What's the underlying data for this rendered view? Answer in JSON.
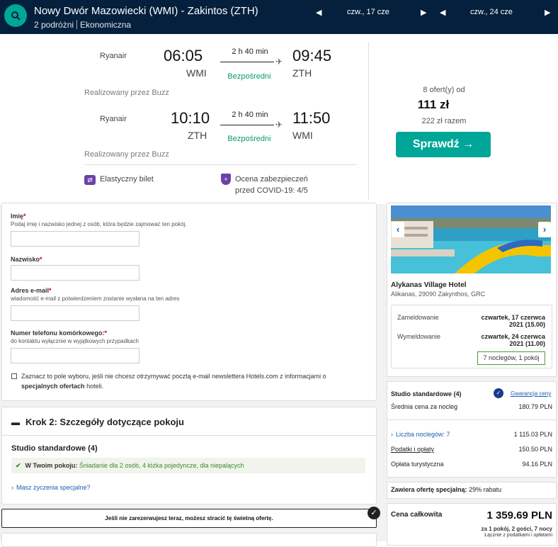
{
  "header": {
    "route": "Nowy Dwór Mazowiecki (WMI) - Zakintos (ZTH)",
    "travellers": "2 podróżni",
    "cabin": "Ekonomiczna",
    "date_out": "czw., 17 cze",
    "date_back": "czw., 24 cze"
  },
  "outbound": {
    "airline": "Ryanair",
    "dep_time": "06:05",
    "dep_iata": "WMI",
    "duration": "2 h 40 min",
    "stops": "Bezpośredni",
    "arr_time": "09:45",
    "arr_iata": "ZTH",
    "operated": "Realizowany przez Buzz"
  },
  "inbound": {
    "airline": "Ryanair",
    "dep_time": "10:10",
    "dep_iata": "ZTH",
    "duration": "2 h 40 min",
    "stops": "Bezpośredni",
    "arr_time": "11:50",
    "arr_iata": "WMI",
    "operated": "Realizowany przez Buzz"
  },
  "features": {
    "flex": "Elastyczny bilet",
    "covid_line1": "Ocena zabezpieczeń",
    "covid_line2": "przed COVID-19: 4/5"
  },
  "offer": {
    "count": "8 ofert(y) od",
    "price": "111 zł",
    "total": "222 zł razem",
    "button": "Sprawdź →"
  },
  "form": {
    "first_name_label": "Imię",
    "first_name_hint": "Podaj imię i nazwisko jednej z osób, która będzie zajmować ten pokój.",
    "last_name_label": "Nazwisko",
    "email_label": "Adres e-mail",
    "email_hint": "wiadomość e-mail z potwierdzeniem zostanie wysłana na ten adres",
    "phone_label": "Numer telefonu komórkowego:",
    "phone_hint": "do kontaktu wyłącznie w wyjątkowych przypadkach",
    "required_mark": "*",
    "newsletter_pre": "Zaznacz to pole wyboru, jeśli nie chcesz otrzymywać pocztą e-mail newslettera Hotels.com z informacjami o",
    "newsletter_bold": "specjalnych ofertach",
    "newsletter_post": "hoteli."
  },
  "step2": {
    "title": "Krok 2: Szczegóły dotyczące pokoju",
    "room": "Studio standardowe (4)",
    "in_room_label": "W Twoim pokoju:",
    "in_room_value": "Śniadanie dla 2 osób, 4 łóżka pojedyncze, dla niepalących",
    "wishes": "Masz życzenia specjalne?",
    "warning": "Jeśli nie zarezerwujesz teraz, możesz stracić tę świetną ofertę."
  },
  "hotel": {
    "name": "Alykanas Village Hotel",
    "address": "Alikanas, 29090 Zakynthos, GRC",
    "checkin_label": "Zameldowanie",
    "checkin_line1": "czwartek, 17 czerwca",
    "checkin_line2": "2021 (15.00)",
    "checkout_label": "Wymeldowanie",
    "checkout_line1": "czwartek, 24 czerwca",
    "checkout_line2": "2021 (11.00)",
    "nights": "7 noclegów, 1 pokój",
    "room": "Studio standardowe (4)",
    "guarantee": "Gwarancja ceny",
    "avg_label": "Średnia cena za nocleg",
    "avg_value": "180.79 PLN",
    "nights_label": "Liczba noclegów: 7",
    "nights_value": "1 115.03 PLN",
    "taxes_label": "Podatki i opłaty",
    "taxes_value": "150.50 PLN",
    "tourist_label": "Opłata turystyczna",
    "tourist_value": "94.16 PLN",
    "special_label": "Zawiera ofertę specjalną:",
    "special_value": "29% rabatu",
    "total_label": "Cena całkowita",
    "total_value": "1 359.69 PLN",
    "total_sub1": "za 1 pokój, 2 gości, 7 nocy",
    "total_sub2": "Łącznie z podatkami i opłatami"
  }
}
